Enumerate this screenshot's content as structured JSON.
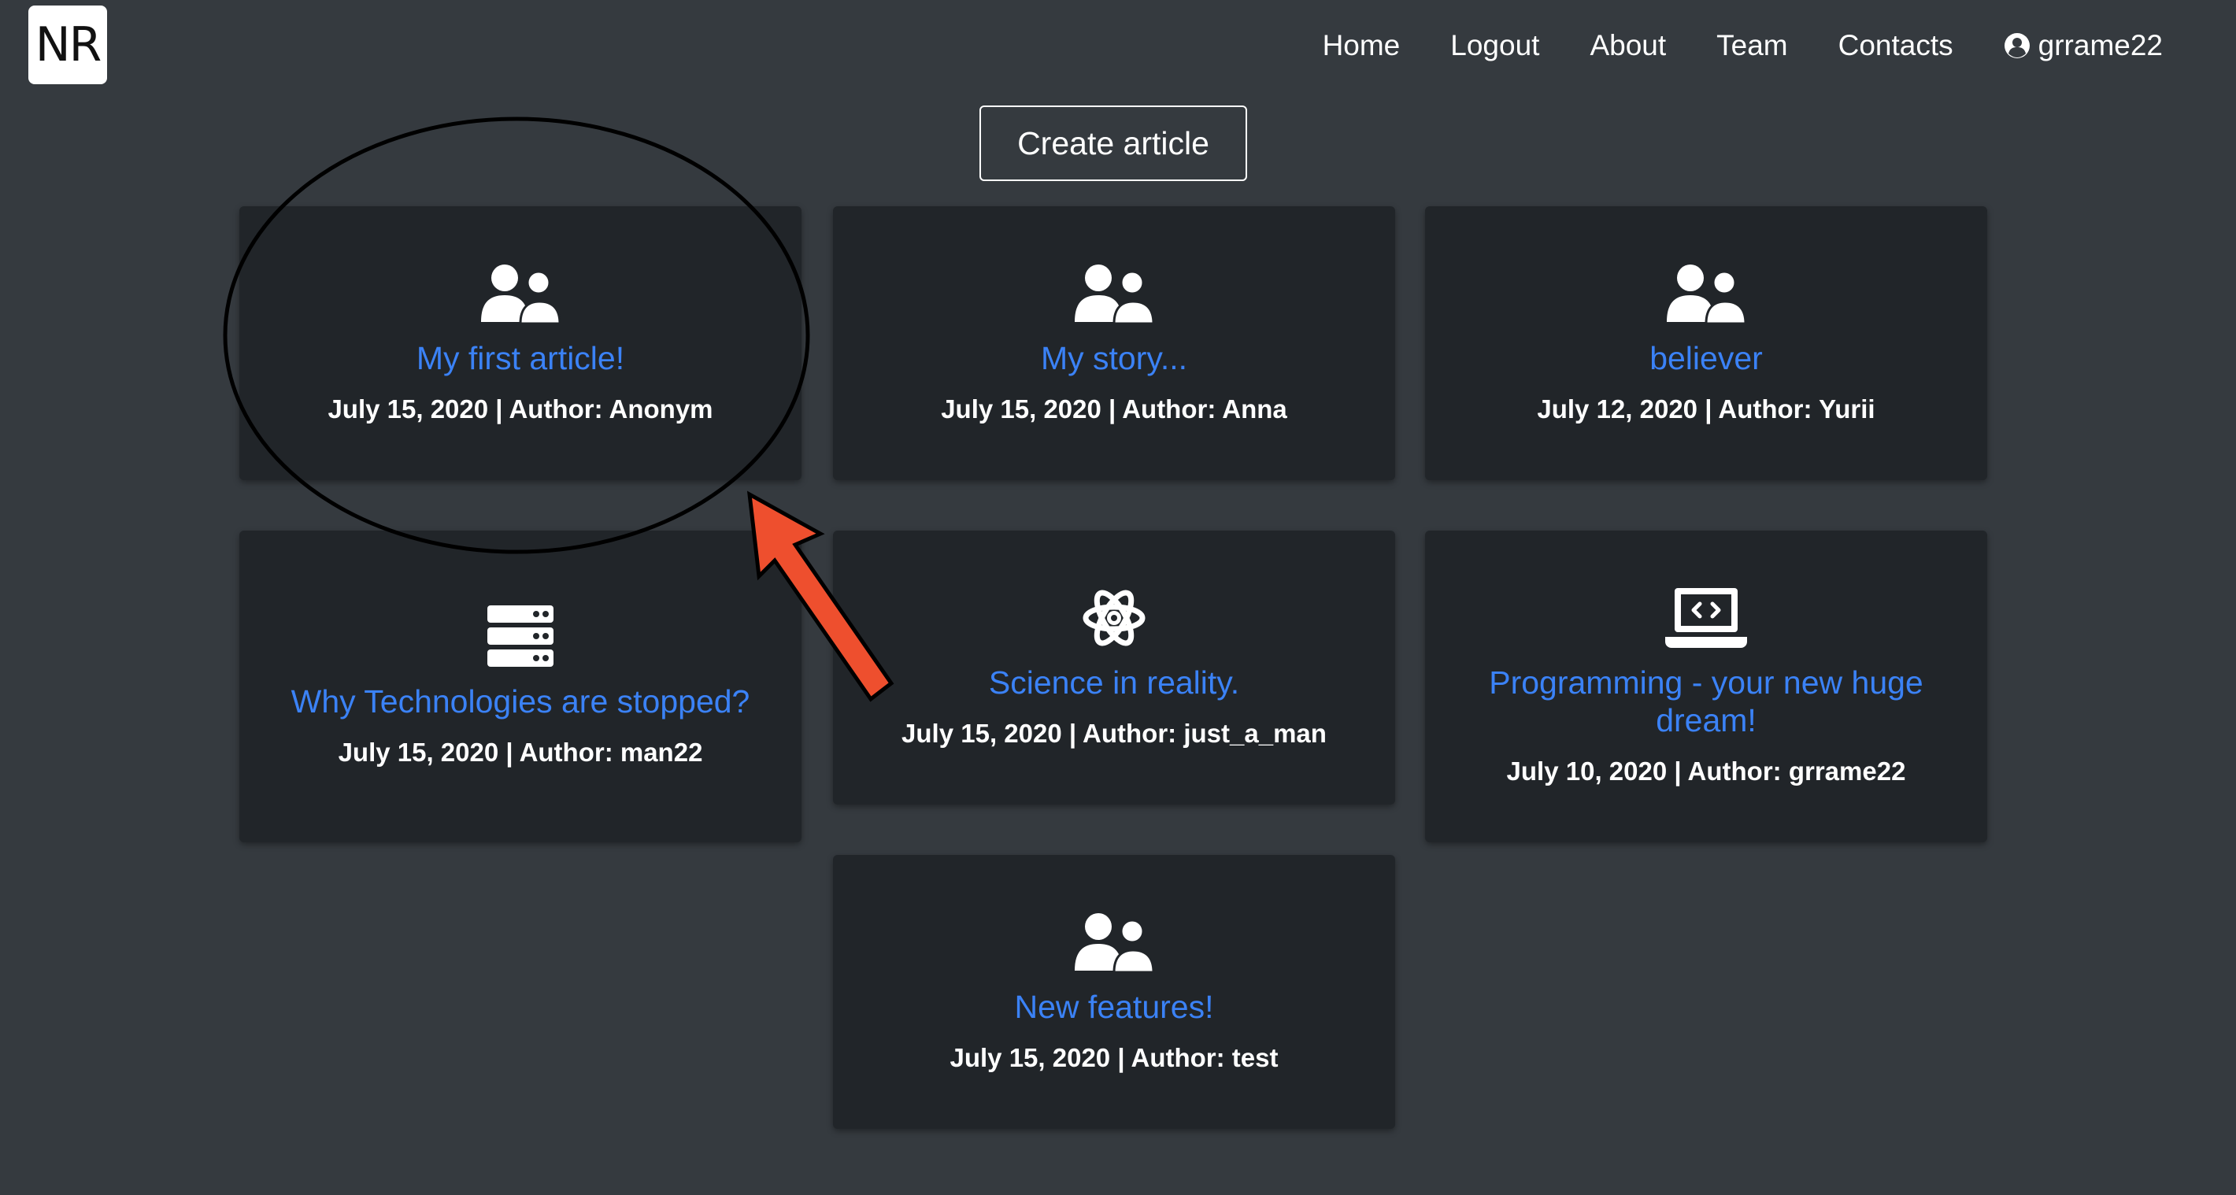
{
  "logo": {
    "text": "NR"
  },
  "nav": {
    "home": "Home",
    "logout": "Logout",
    "about": "About",
    "team": "Team",
    "contacts": "Contacts",
    "user": "grrame22"
  },
  "create_button": "Create article",
  "articles": [
    {
      "title": "My first article!",
      "meta": "July 15, 2020 | Author: Anonym",
      "icon": "users-icon"
    },
    {
      "title": "My story...",
      "meta": "July 15, 2020 | Author: Anna",
      "icon": "users-icon"
    },
    {
      "title": "believer",
      "meta": "July 12, 2020 | Author: Yurii",
      "icon": "users-icon"
    },
    {
      "title": "Why Technologies are stopped?",
      "meta": "July 15, 2020 | Author: man22",
      "icon": "server-icon"
    },
    {
      "title": "Science in reality.",
      "meta": "July 15, 2020 | Author: just_a_man",
      "icon": "atom-icon"
    },
    {
      "title": "Programming - your new huge dream!",
      "meta": "July 10, 2020 | Author: grrame22",
      "icon": "laptop-code-icon"
    },
    {
      "title": "New features!",
      "meta": "July 15, 2020 | Author: test",
      "icon": "users-icon"
    }
  ],
  "colors": {
    "background": "#353a3f",
    "card": "#212529",
    "title_link": "#3b82f6",
    "annotation_arrow": "#ee4f2e"
  }
}
